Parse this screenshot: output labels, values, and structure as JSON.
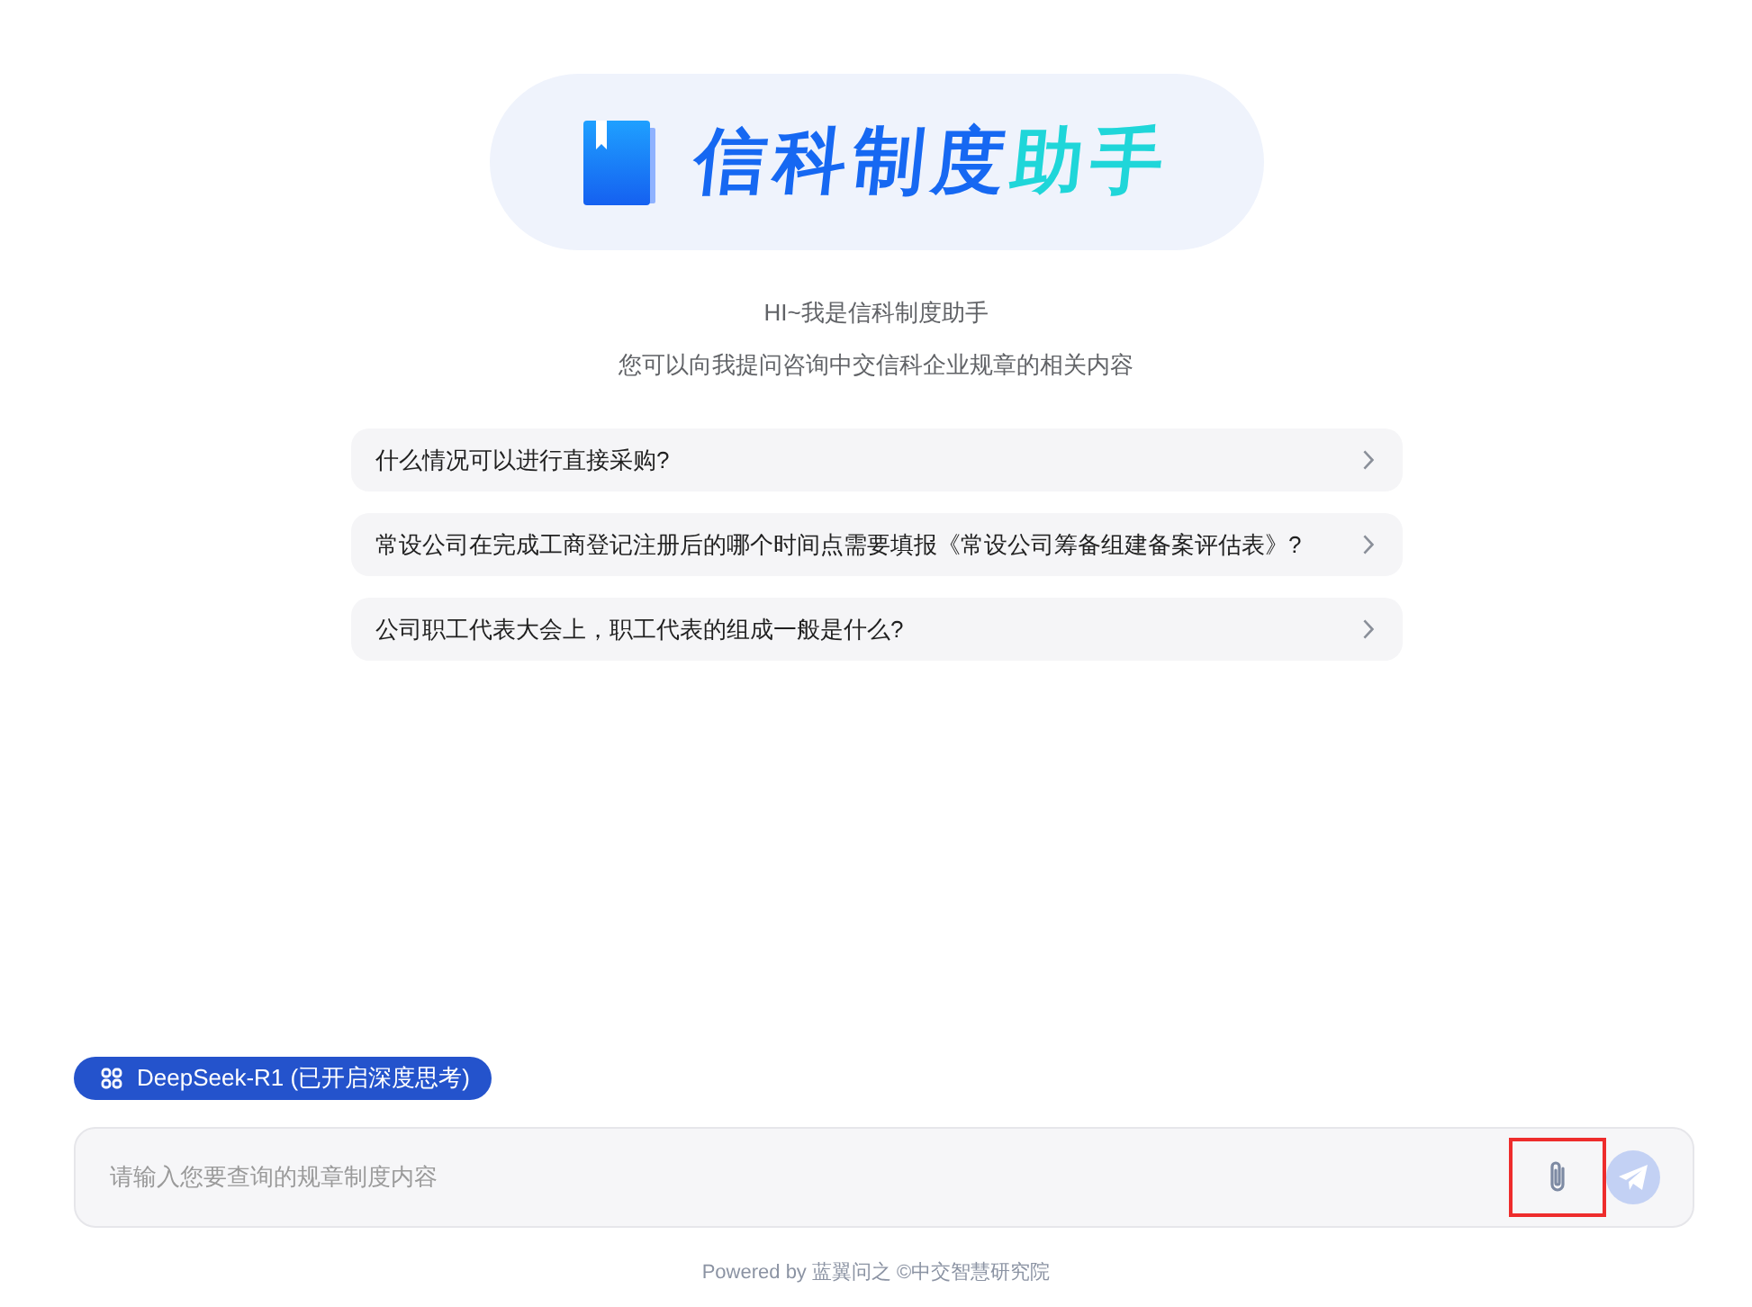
{
  "logo": {
    "title_parts": [
      {
        "text": "信科制度",
        "kind": "primary"
      },
      {
        "text": "助手",
        "kind": "accent"
      }
    ]
  },
  "greeting": [
    "HI~我是信科制度助手",
    "您可以向我提问咨询中交信科企业规章的相关内容"
  ],
  "suggestions": [
    {
      "text": "什么情况可以进行直接采购?"
    },
    {
      "text": "常设公司在完成工商登记注册后的哪个时间点需要填报《常设公司筹备组建备案评估表》?"
    },
    {
      "text": "公司职工代表大会上，职工代表的组成一般是什么?"
    }
  ],
  "model_chip": {
    "label": "DeepSeek-R1 (已开启深度思考)"
  },
  "input": {
    "placeholder": "请输入您要查询的规章制度内容",
    "attach_highlighted": true,
    "send_disabled": true
  },
  "footer": "Powered by 蓝翼问之 ©中交智慧研究院"
}
